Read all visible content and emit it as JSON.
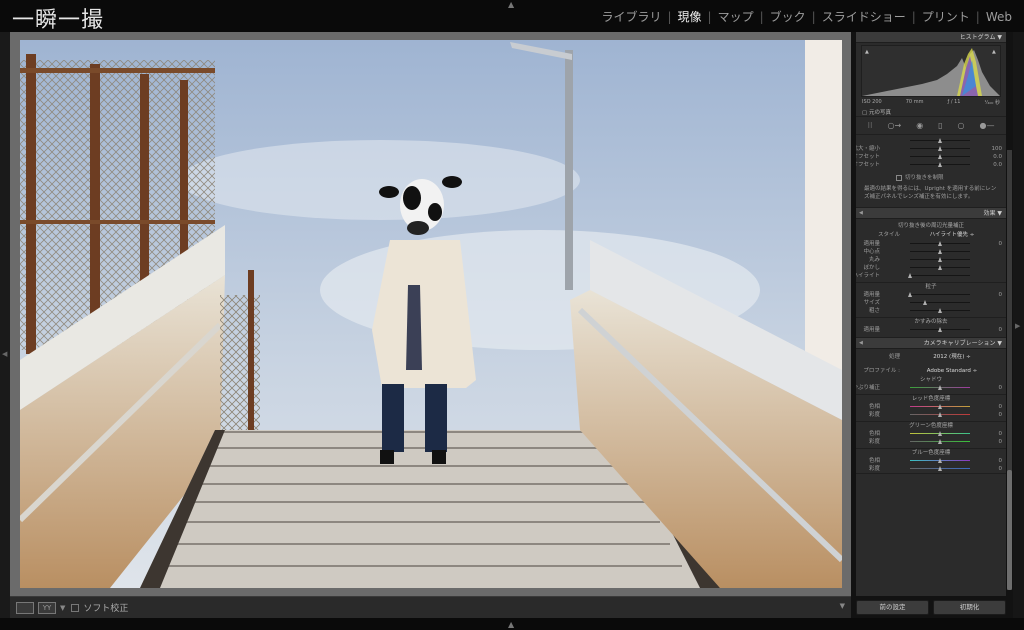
{
  "app": {
    "brand": "一瞬一撮"
  },
  "modules": [
    {
      "label": "ライブラリ",
      "active": false
    },
    {
      "label": "現像",
      "active": true
    },
    {
      "label": "マップ",
      "active": false
    },
    {
      "label": "ブック",
      "active": false
    },
    {
      "label": "スライドショー",
      "active": false
    },
    {
      "label": "プリント",
      "active": false
    },
    {
      "label": "Web",
      "active": false
    }
  ],
  "histogram": {
    "title": "ヒストグラム",
    "iso": "ISO 200",
    "focal": "70 mm",
    "aperture": "ƒ / 11",
    "shutter": "¹⁄₄₀₀ 秒",
    "original_photo": "元の写真"
  },
  "crop": {
    "sliders": [
      {
        "label": "拡大・縮小",
        "value": "100",
        "pos": 0.5
      },
      {
        "label": "X オフセット",
        "value": "0.0",
        "pos": 0.5
      },
      {
        "label": "Y オフセット",
        "value": "0.0",
        "pos": 0.5
      }
    ],
    "constrain": "切り抜きを制限",
    "note": "最適の結果を得るには、Upright を適用する前にレンズ補正パネルでレンズ補正を有効にします。"
  },
  "effects": {
    "title": "効果",
    "vignette_title": "切り抜き後の周辺光量補正",
    "style_label": "スタイル",
    "style_value": "ハイライト優先 ÷",
    "vignette_sliders": [
      {
        "label": "適用量",
        "value": "0",
        "pos": 0.5
      },
      {
        "label": "中心点",
        "value": "",
        "pos": 0.5
      },
      {
        "label": "丸み",
        "value": "",
        "pos": 0.5
      },
      {
        "label": "ぼかし",
        "value": "",
        "pos": 0.5
      },
      {
        "label": "ハイライト",
        "value": "",
        "pos": 0.0
      }
    ],
    "grain_title": "粒子",
    "grain_sliders": [
      {
        "label": "適用量",
        "value": "0",
        "pos": 0.0
      },
      {
        "label": "サイズ",
        "value": "",
        "pos": 0.25
      },
      {
        "label": "粗さ",
        "value": "",
        "pos": 0.5
      }
    ],
    "dehaze_title": "かすみの除去",
    "dehaze_sliders": [
      {
        "label": "適用量",
        "value": "0",
        "pos": 0.5
      }
    ]
  },
  "calibration": {
    "title": "カメラキャリブレーション",
    "process_label": "処理",
    "process_value": "2012 (現在) ÷",
    "profile_label": "プロファイル :",
    "profile_value": "Adobe Standard ÷",
    "shadows_title": "シャドウ",
    "shadows_sliders": [
      {
        "label": "色かぶり補正",
        "value": "0",
        "pos": 0.5
      }
    ],
    "red_title": "レッド色度座標",
    "red_sliders": [
      {
        "label": "色相",
        "value": "0",
        "pos": 0.5
      },
      {
        "label": "彩度",
        "value": "0",
        "pos": 0.5
      }
    ],
    "green_title": "グリーン色度座標",
    "green_sliders": [
      {
        "label": "色相",
        "value": "0",
        "pos": 0.5
      },
      {
        "label": "彩度",
        "value": "0",
        "pos": 0.5
      }
    ],
    "blue_title": "ブルー色度座標",
    "blue_sliders": [
      {
        "label": "色相",
        "value": "0",
        "pos": 0.5
      },
      {
        "label": "彩度",
        "value": "0",
        "pos": 0.5
      }
    ]
  },
  "toolbar": {
    "soft_proof": "ソフト校正",
    "view_label": "YY"
  },
  "buttons": {
    "previous": "前の設定",
    "reset": "初期化"
  }
}
